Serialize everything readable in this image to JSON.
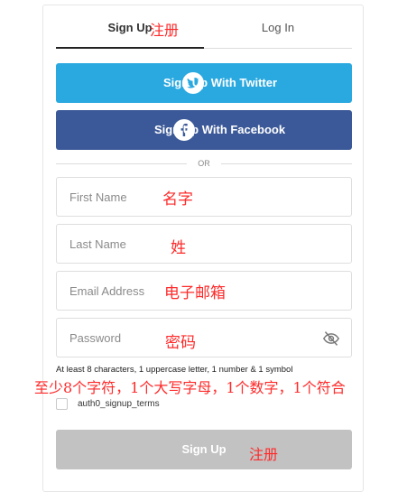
{
  "tabs": {
    "signup": "Sign Up",
    "login": "Log In",
    "signup_annotation": "注册"
  },
  "social": {
    "twitter_label": "Sign Up With Twitter",
    "facebook_label": "Sign Up With Facebook",
    "twitter_icon": "twitter-bird-icon",
    "facebook_icon": "facebook-f-icon"
  },
  "divider": {
    "text": "OR"
  },
  "fields": {
    "first_name": {
      "placeholder": "First Name",
      "value": "",
      "annotation": "名字"
    },
    "last_name": {
      "placeholder": "Last Name",
      "value": "",
      "annotation": "姓"
    },
    "email": {
      "placeholder": "Email Address",
      "value": "",
      "annotation": "电子邮箱"
    },
    "password": {
      "placeholder": "Password",
      "value": "",
      "annotation": "密码",
      "toggle_icon": "eye-slash-icon"
    }
  },
  "password_hint": "At least 8 characters, 1 uppercase letter, 1 number & 1 symbol",
  "password_hint_annotation": "至少8个字符，1个大写字母，1个数字，1个符合",
  "terms": {
    "label": "auth0_signup_terms",
    "checked": false
  },
  "submit": {
    "label": "Sign Up",
    "annotation": "注册"
  },
  "colors": {
    "twitter": "#2aa9e0",
    "facebook": "#3b5998",
    "submit_disabled": "#c2c2c2",
    "annotation": "#ff2a2a"
  }
}
